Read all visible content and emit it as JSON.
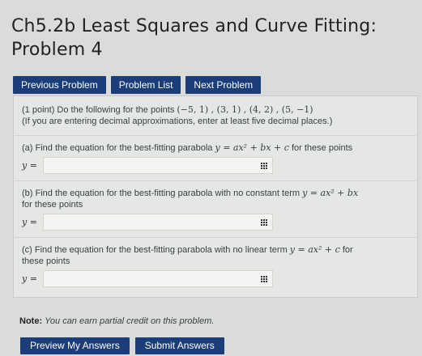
{
  "header": {
    "title_line1": "Ch5.2b Least Squares and Curve Fitting:",
    "title_line2": "Problem 4"
  },
  "nav": {
    "previous_label": "Previous Problem",
    "list_label": "Problem List",
    "next_label": "Next Problem"
  },
  "problem": {
    "points_prefix": "(1 point) Do the following for the points ",
    "points": "(−5, 1) , (3, 1) , (4, 2) , (5, −1)",
    "decimal_note": "(If you are entering decimal approximations, enter at least five decimal places.)",
    "part_a": {
      "prefix": "(a) Find the equation for the best-fitting parabola ",
      "formula": "y = ax² + bx + c",
      "suffix": " for these points",
      "answer_label": "y =",
      "answer_value": ""
    },
    "part_b": {
      "prefix": "(b) Find the equation for the best-fitting parabola with no constant term ",
      "formula": "y = ax² + bx",
      "line2": "for these points",
      "answer_label": "y =",
      "answer_value": ""
    },
    "part_c": {
      "prefix": "(c) Find the equation for the best-fitting parabola with no linear term ",
      "formula": "y = ax² + c",
      "suffix": " for",
      "line2": "these points",
      "answer_label": "y =",
      "answer_value": ""
    }
  },
  "note": {
    "label": "Note:",
    "text": "You can earn partial credit on this problem."
  },
  "actions": {
    "preview_label": "Preview My Answers",
    "submit_label": "Submit Answers"
  },
  "icons": {
    "equation_editor": "grid-icon"
  },
  "colors": {
    "button_bg": "#1b3d7a",
    "page_bg": "#d9dcd8"
  }
}
